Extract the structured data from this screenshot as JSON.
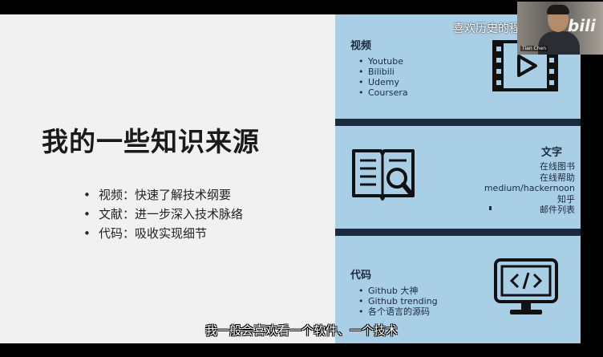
{
  "slide": {
    "title": "我的一些知识来源",
    "bullets": [
      {
        "label": "视频：快速了解技术纲要"
      },
      {
        "label": "文献：进一步深入技术脉络"
      },
      {
        "label": "代码：吸收实现细节"
      }
    ]
  },
  "panel": {
    "video": {
      "heading": "视频",
      "items": [
        "Youtube",
        "Bilibili",
        "Udemy",
        "Coursera"
      ],
      "icon": "video-play-icon"
    },
    "text": {
      "heading": "文字",
      "items": [
        "在线图书",
        "在线帮助",
        "medium/hackernoon",
        "知乎",
        "邮件列表"
      ],
      "icon": "book-search-icon"
    },
    "code": {
      "heading": "代码",
      "items": [
        "Github 大神",
        "Github trending",
        "各个语言的源码"
      ],
      "icon": "code-monitor-icon"
    }
  },
  "overlay": {
    "channel": "喜欢历史的程序员",
    "webcam_name": "Tian Chen",
    "site_logo": "bili",
    "subtitle": "我一般会喜欢看一个软件、一个技术"
  },
  "colors": {
    "panel_bg": "#a9cfe6",
    "band": "#1b2a3f",
    "slide_bg": "#f1f1f1"
  }
}
